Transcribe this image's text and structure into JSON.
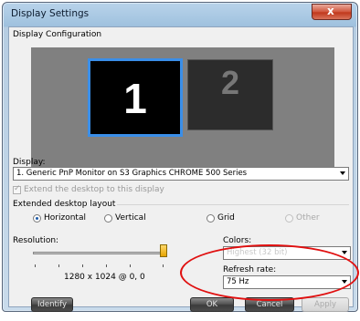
{
  "window": {
    "title": "Display Settings",
    "close_glyph": "x"
  },
  "section": {
    "title": "Display Configuration"
  },
  "preview": {
    "monitor1": "1",
    "monitor2": "2"
  },
  "display": {
    "label": "Display:",
    "value": "1. Generic PnP Monitor on S3 Graphics CHROME 500 Series"
  },
  "extend": {
    "label": "Extend the desktop to this display",
    "checked": true,
    "enabled": false
  },
  "layout": {
    "label": "Extended desktop layout",
    "options": [
      {
        "label": "Horizontal",
        "selected": true
      },
      {
        "label": "Vertical",
        "selected": false
      },
      {
        "label": "Grid",
        "selected": false
      },
      {
        "label": "Other",
        "selected": false
      }
    ]
  },
  "resolution": {
    "label": "Resolution:",
    "readout": "1280 x 1024 @ 0, 0",
    "level": 1.0
  },
  "colors": {
    "label": "Colors:",
    "value": "Highest (32 bit)"
  },
  "refresh": {
    "label": "Refresh rate:",
    "value": "75 Hz"
  },
  "buttons": {
    "identify": "Identify",
    "ok": "OK",
    "cancel": "Cancel",
    "apply": "Apply"
  },
  "highlight_color": "#e01010",
  "icons": {
    "close": "close-icon",
    "dropdown": "chevron-down-icon",
    "check": "check-icon"
  }
}
